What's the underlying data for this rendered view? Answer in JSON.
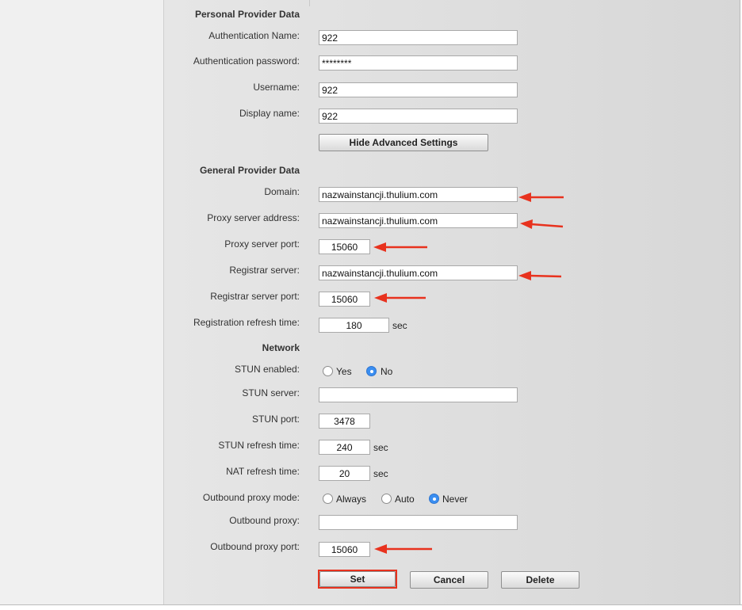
{
  "personal": {
    "title": "Personal Provider Data",
    "auth_name_label": "Authentication Name:",
    "auth_name_value": "922",
    "auth_password_label": "Authentication password:",
    "auth_password_value": "********",
    "username_label": "Username:",
    "username_value": "922",
    "display_name_label": "Display name:",
    "display_name_value": "922",
    "hide_advanced_label": "Hide Advanced Settings"
  },
  "general": {
    "title": "General Provider Data",
    "domain_label": "Domain:",
    "domain_value": "nazwainstancji.thulium.com",
    "proxy_address_label": "Proxy server address:",
    "proxy_address_value": "nazwainstancji.thulium.com",
    "proxy_port_label": "Proxy server port:",
    "proxy_port_value": "15060",
    "registrar_server_label": "Registrar server:",
    "registrar_server_value": "nazwainstancji.thulium.com",
    "registrar_port_label": "Registrar server port:",
    "registrar_port_value": "15060",
    "reg_refresh_label": "Registration refresh time:",
    "reg_refresh_value": "180",
    "sec_unit": "sec"
  },
  "network": {
    "title": "Network",
    "stun_enabled_label": "STUN enabled:",
    "stun_yes": "Yes",
    "stun_no": "No",
    "stun_selected": "No",
    "stun_server_label": "STUN server:",
    "stun_server_value": "",
    "stun_port_label": "STUN port:",
    "stun_port_value": "3478",
    "stun_refresh_label": "STUN refresh time:",
    "stun_refresh_value": "240",
    "nat_refresh_label": "NAT refresh time:",
    "nat_refresh_value": "20",
    "sec_unit": "sec",
    "outbound_mode_label": "Outbound proxy mode:",
    "mode_always": "Always",
    "mode_auto": "Auto",
    "mode_never": "Never",
    "mode_selected": "Never",
    "outbound_proxy_label": "Outbound proxy:",
    "outbound_proxy_value": "",
    "outbound_port_label": "Outbound proxy port:",
    "outbound_port_value": "15060"
  },
  "actions": {
    "set_label": "Set",
    "cancel_label": "Cancel",
    "delete_label": "Delete"
  },
  "annotation": {
    "arrow_color": "#e8321e"
  }
}
